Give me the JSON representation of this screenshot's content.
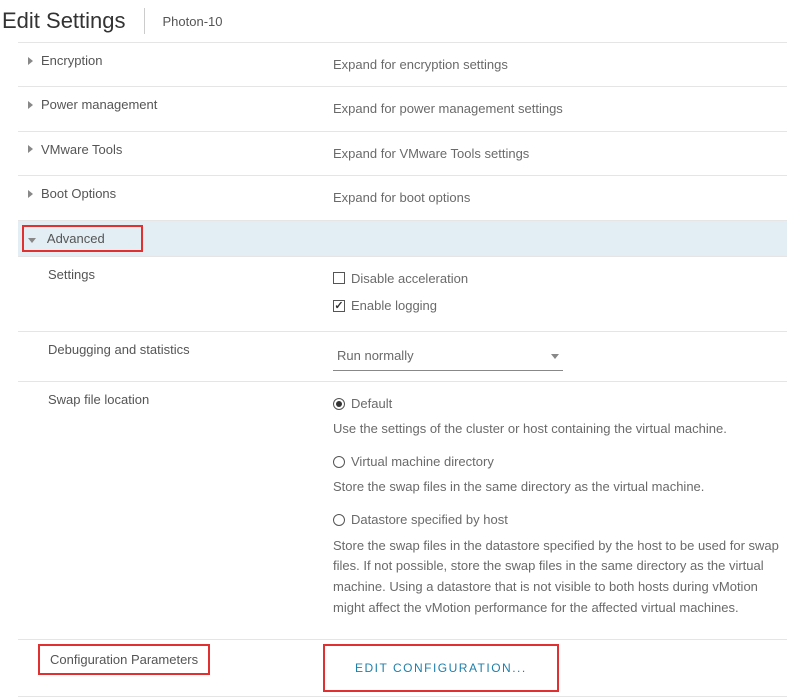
{
  "header": {
    "title": "Edit Settings",
    "context": "Photon-10"
  },
  "rows": {
    "encryption": {
      "label": "Encryption",
      "value": "Expand for encryption settings"
    },
    "power": {
      "label": "Power management",
      "value": "Expand for power management settings"
    },
    "vmtools": {
      "label": "VMware Tools",
      "value": "Expand for VMware Tools settings"
    },
    "boot": {
      "label": "Boot Options",
      "value": "Expand for boot options"
    },
    "advanced": {
      "label": "Advanced"
    },
    "settings": {
      "label": "Settings",
      "disable_accel": "Disable acceleration",
      "enable_logging": "Enable logging"
    },
    "debug": {
      "label": "Debugging and statistics",
      "value": "Run normally"
    },
    "swap": {
      "label": "Swap file location",
      "opts": {
        "default": {
          "label": "Default",
          "desc": "Use the settings of the cluster or host containing the virtual machine."
        },
        "vmdir": {
          "label": "Virtual machine directory",
          "desc": "Store the swap files in the same directory as the virtual machine."
        },
        "dshost": {
          "label": "Datastore specified by host",
          "desc": "Store the swap files in the datastore specified by the host to be used for swap files. If not possible, store the swap files in the same directory as the virtual machine. Using a datastore that is not visible to both hosts during vMotion might affect the vMotion performance for the affected virtual machines."
        }
      }
    },
    "configparams": {
      "label": "Configuration Parameters",
      "button": "EDIT CONFIGURATION..."
    }
  }
}
